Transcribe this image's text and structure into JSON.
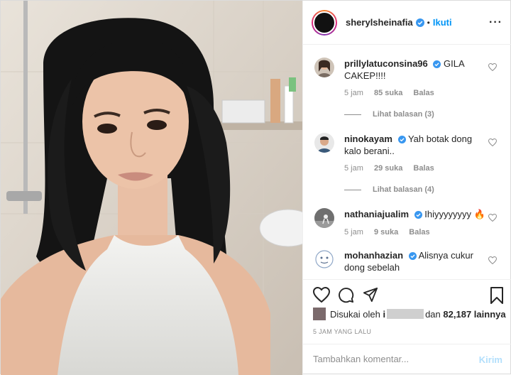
{
  "header": {
    "username": "sherylsheinafia",
    "separator": "•",
    "follow_label": "Ikuti",
    "more_label": "···"
  },
  "comments": [
    {
      "username": "prillylatuconsina96",
      "text": "GILA CAKEP!!!!",
      "time": "5 jam",
      "likes": "85 suka",
      "reply": "Balas",
      "view_replies": "Lihat balasan (3)",
      "verified": true
    },
    {
      "username": "ninokayam",
      "text": "Yah botak dong kalo berani..",
      "time": "5 jam",
      "likes": "29 suka",
      "reply": "Balas",
      "view_replies": "Lihat balasan (4)",
      "verified": true
    },
    {
      "username": "nathaniajualim",
      "text": "Ihiyyyyyyyy 🔥",
      "time": "5 jam",
      "likes": "9 suka",
      "reply": "Balas",
      "verified": true
    },
    {
      "username": "mohanhazian",
      "text": "Alisnya cukur dong sebelah",
      "verified": true
    }
  ],
  "likes": {
    "prefix": "Disukai oleh",
    "first_letter": "i",
    "middle": "dan",
    "count": "82,187",
    "suffix": "lainnya"
  },
  "timestamp": "5 JAM YANG LALU",
  "add_comment": {
    "placeholder": "Tambahkan komentar...",
    "post_label": "Kirim"
  },
  "colors": {
    "accent": "#0095f6",
    "verified": "#3897f0",
    "muted": "#8e8e8e",
    "post_disabled": "#b2dffc"
  },
  "icons": [
    "heart-icon",
    "comment-icon",
    "share-icon",
    "bookmark-icon",
    "verified-badge-icon",
    "more-icon"
  ]
}
